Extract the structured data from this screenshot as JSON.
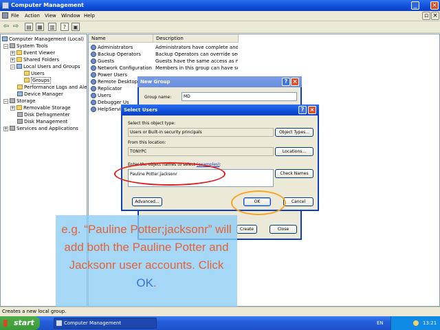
{
  "window": {
    "title": "Computer Management"
  },
  "menu": [
    "File",
    "Action",
    "View",
    "Window",
    "Help"
  ],
  "tree": {
    "items": [
      {
        "label": "Computer Management (Local)",
        "indent": 0,
        "icon": "computer-icon"
      },
      {
        "label": "System Tools",
        "indent": 1,
        "icon": "tools-icon"
      },
      {
        "label": "Event Viewer",
        "indent": 2,
        "icon": "folder-icon"
      },
      {
        "label": "Shared Folders",
        "indent": 2,
        "icon": "folder-icon"
      },
      {
        "label": "Local Users and Groups",
        "indent": 2,
        "icon": "users-icon"
      },
      {
        "label": "Users",
        "indent": 3,
        "icon": "folder-icon"
      },
      {
        "label": "Groups",
        "indent": 3,
        "icon": "folder-icon",
        "selected": true
      },
      {
        "label": "Performance Logs and Alerts",
        "indent": 2,
        "icon": "folder-icon"
      },
      {
        "label": "Device Manager",
        "indent": 2,
        "icon": "computer-icon"
      },
      {
        "label": "Storage",
        "indent": 1,
        "icon": "tools-icon"
      },
      {
        "label": "Removable Storage",
        "indent": 2,
        "icon": "folder-icon"
      },
      {
        "label": "Disk Defragmenter",
        "indent": 2,
        "icon": "folder-icon"
      },
      {
        "label": "Disk Management",
        "indent": 2,
        "icon": "folder-icon"
      },
      {
        "label": "Services and Applications",
        "indent": 1,
        "icon": "tools-icon"
      }
    ]
  },
  "list": {
    "columns": [
      "Name",
      "Description"
    ],
    "rows": [
      {
        "name": "Administrators",
        "desc": "Administrators have complete and u..."
      },
      {
        "name": "Backup Operators",
        "desc": "Backup Operators can override secu..."
      },
      {
        "name": "Guests",
        "desc": "Guests have the same access as me..."
      },
      {
        "name": "Network Configuration ...",
        "desc": "Members in this group can have som..."
      },
      {
        "name": "Power Users",
        "desc": ""
      },
      {
        "name": "Remote Desktop Us",
        "desc": ""
      },
      {
        "name": "Replicator",
        "desc": ""
      },
      {
        "name": "Users",
        "desc": ""
      },
      {
        "name": "Debugger Us",
        "desc": ""
      },
      {
        "name": "HelpService",
        "desc": ""
      }
    ]
  },
  "status": "Creates a new local group.",
  "taskbar": {
    "start": "start",
    "task": "Computer Management",
    "lang": "EN",
    "clock": "13:21"
  },
  "new_group": {
    "title": "New Group",
    "group_name_label": "Group name:",
    "group_name_value": "MD",
    "create": "Create",
    "close": "Close"
  },
  "select_users": {
    "title": "Select Users",
    "type_label": "Select this object type:",
    "type_value": "Users or Built-in security principals",
    "object_types": "Object Types...",
    "location_label": "From this location:",
    "location_value": "TONYPC",
    "locations": "Locations...",
    "names_label": "Enter the object names to select",
    "examples": "(examples)",
    "names_value": "Pauline Potter;jacksonr",
    "check_names": "Check Names",
    "advanced": "Advanced...",
    "ok": "OK",
    "cancel": "Cancel"
  },
  "callout": {
    "part1": "e.g. “Pauline Potter;jacksonr” will add both the Pauline Potter and Jacksonr user accounts. Click ",
    "ok": "OK",
    "period": "."
  },
  "colors": {
    "titlebar": "#0f4fd8",
    "annotation_red": "#e21b1b",
    "annotation_orange": "#f5a623",
    "callout_text": "#e2633a",
    "callout_highlight": "#3f6fd6"
  }
}
